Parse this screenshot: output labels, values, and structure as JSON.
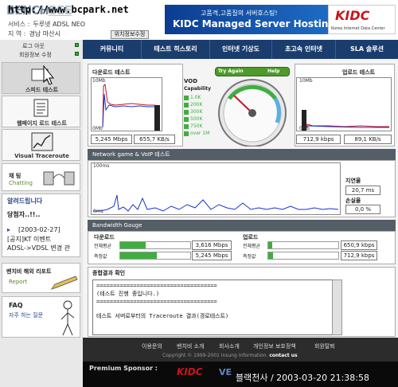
{
  "watermark": "http://www.bcpark.net",
  "logo": {
    "text": "BENCH",
    "text_tail": "BEE"
  },
  "service": {
    "label_service": "서비스 :",
    "value_service": "두루넷 ADSL NEO",
    "label_region": "지 역 :",
    "value_region": "경남 마산시",
    "location_button": "위치정보수정"
  },
  "banner": {
    "top": "고품격,고품질의 서버호스팅!",
    "main": "KIDC Managed Server Hosting",
    "kidc": "KIDC",
    "kidc_sub": "Korea Internet Data Center"
  },
  "nav": [
    "커뮤니티",
    "테스트 히스토리",
    "인터넷 기상도",
    "초고속 인터넷",
    "SLA 솔루션"
  ],
  "sidebar": {
    "login": "로그 아웃",
    "member_edit": "회원정보 수정",
    "speed_test": "스피드 테스트",
    "webpage_test": "웹페이지 로드 테스트",
    "visual_traceroute": "Visual Traceroute",
    "chatting_ko": "채 팅",
    "chatting_en": "Chatting",
    "notice_title": "알려드립니다",
    "notice_line": "당첨자..!!..",
    "notice_date": "[2003-02-27]",
    "notice_item": "[공지]KT 이벤트",
    "notice_item2": "ADSL->VDSL 변경 관",
    "benchbee_report_ko": "밴치비 해외 리포트",
    "benchbee_report_en": "Report",
    "faq": "FAQ",
    "faq_sub": "자주 하는 질문"
  },
  "download": {
    "title": "다운로드 테스트",
    "top_scale": "10Mb",
    "bottom_scale": "0Mb",
    "speed_mbps": "5,245 Mbps",
    "speed_kbs": "655,7 KB/s"
  },
  "vod": {
    "title": "VOD",
    "subtitle": "Capability",
    "levels": [
      "1.0K",
      "200K",
      "300K",
      "500K",
      "750K",
      "over 1M"
    ]
  },
  "gauge": {
    "try_again": "Try Again",
    "help": "Help"
  },
  "upload": {
    "title": "업로드 테스트",
    "top_scale": "10Mb",
    "bottom_scale": "0Mb",
    "speed_kbps": "712,9 kbps",
    "speed_kbs": "89,1 KB/s"
  },
  "network_game": {
    "title": "Network game & VoIP 테스트",
    "top_scale": "100ms",
    "bottom_scale": "0ms",
    "latency_label": "지연율",
    "latency_value": "20,7 ms",
    "loss_label": "손실율",
    "loss_value": "0,0 %"
  },
  "bandwidth": {
    "title": "Bandwidth Gauge",
    "download_title": "다운로드",
    "upload_title": "업로드",
    "avg_label": "전체평균",
    "measured_label": "측정값",
    "dl_avg": "3,616 Mbps",
    "dl_measured": "5,245 Mbps",
    "ul_avg": "650,9 kbps",
    "ul_measured": "712,9 kbps",
    "dl_avg_fill": 0.36,
    "dl_measured_fill": 0.52,
    "ul_avg_fill": 0.06,
    "ul_measured_fill": 0.07
  },
  "result": {
    "title": "종합결과 확인",
    "line1": "====================================",
    "line2": "(테스트 진행 중입니다.)",
    "line3": "====================================",
    "line4": "테스트 서버로부터의 Traceroute 결과(경로테스트)"
  },
  "footer": {
    "links": [
      "이용문의",
      "밴치비 소개",
      "회사소개",
      "개인정보 보호정책",
      "회원탈퇴"
    ],
    "copyright": "Copyright © 1999-2001 Insung Information.",
    "contact": "contact us",
    "premium": "Premium Sponsor :",
    "sponsor1": "KIDC",
    "sponsor2": "VE",
    "overlay": "블랙천사 / 2003-03-20 21:38:58"
  },
  "colors": {
    "accent": "#1a3d6e",
    "green": "#3fae3f",
    "red": "#c8161d",
    "plot_blue": "#1a33c8"
  }
}
